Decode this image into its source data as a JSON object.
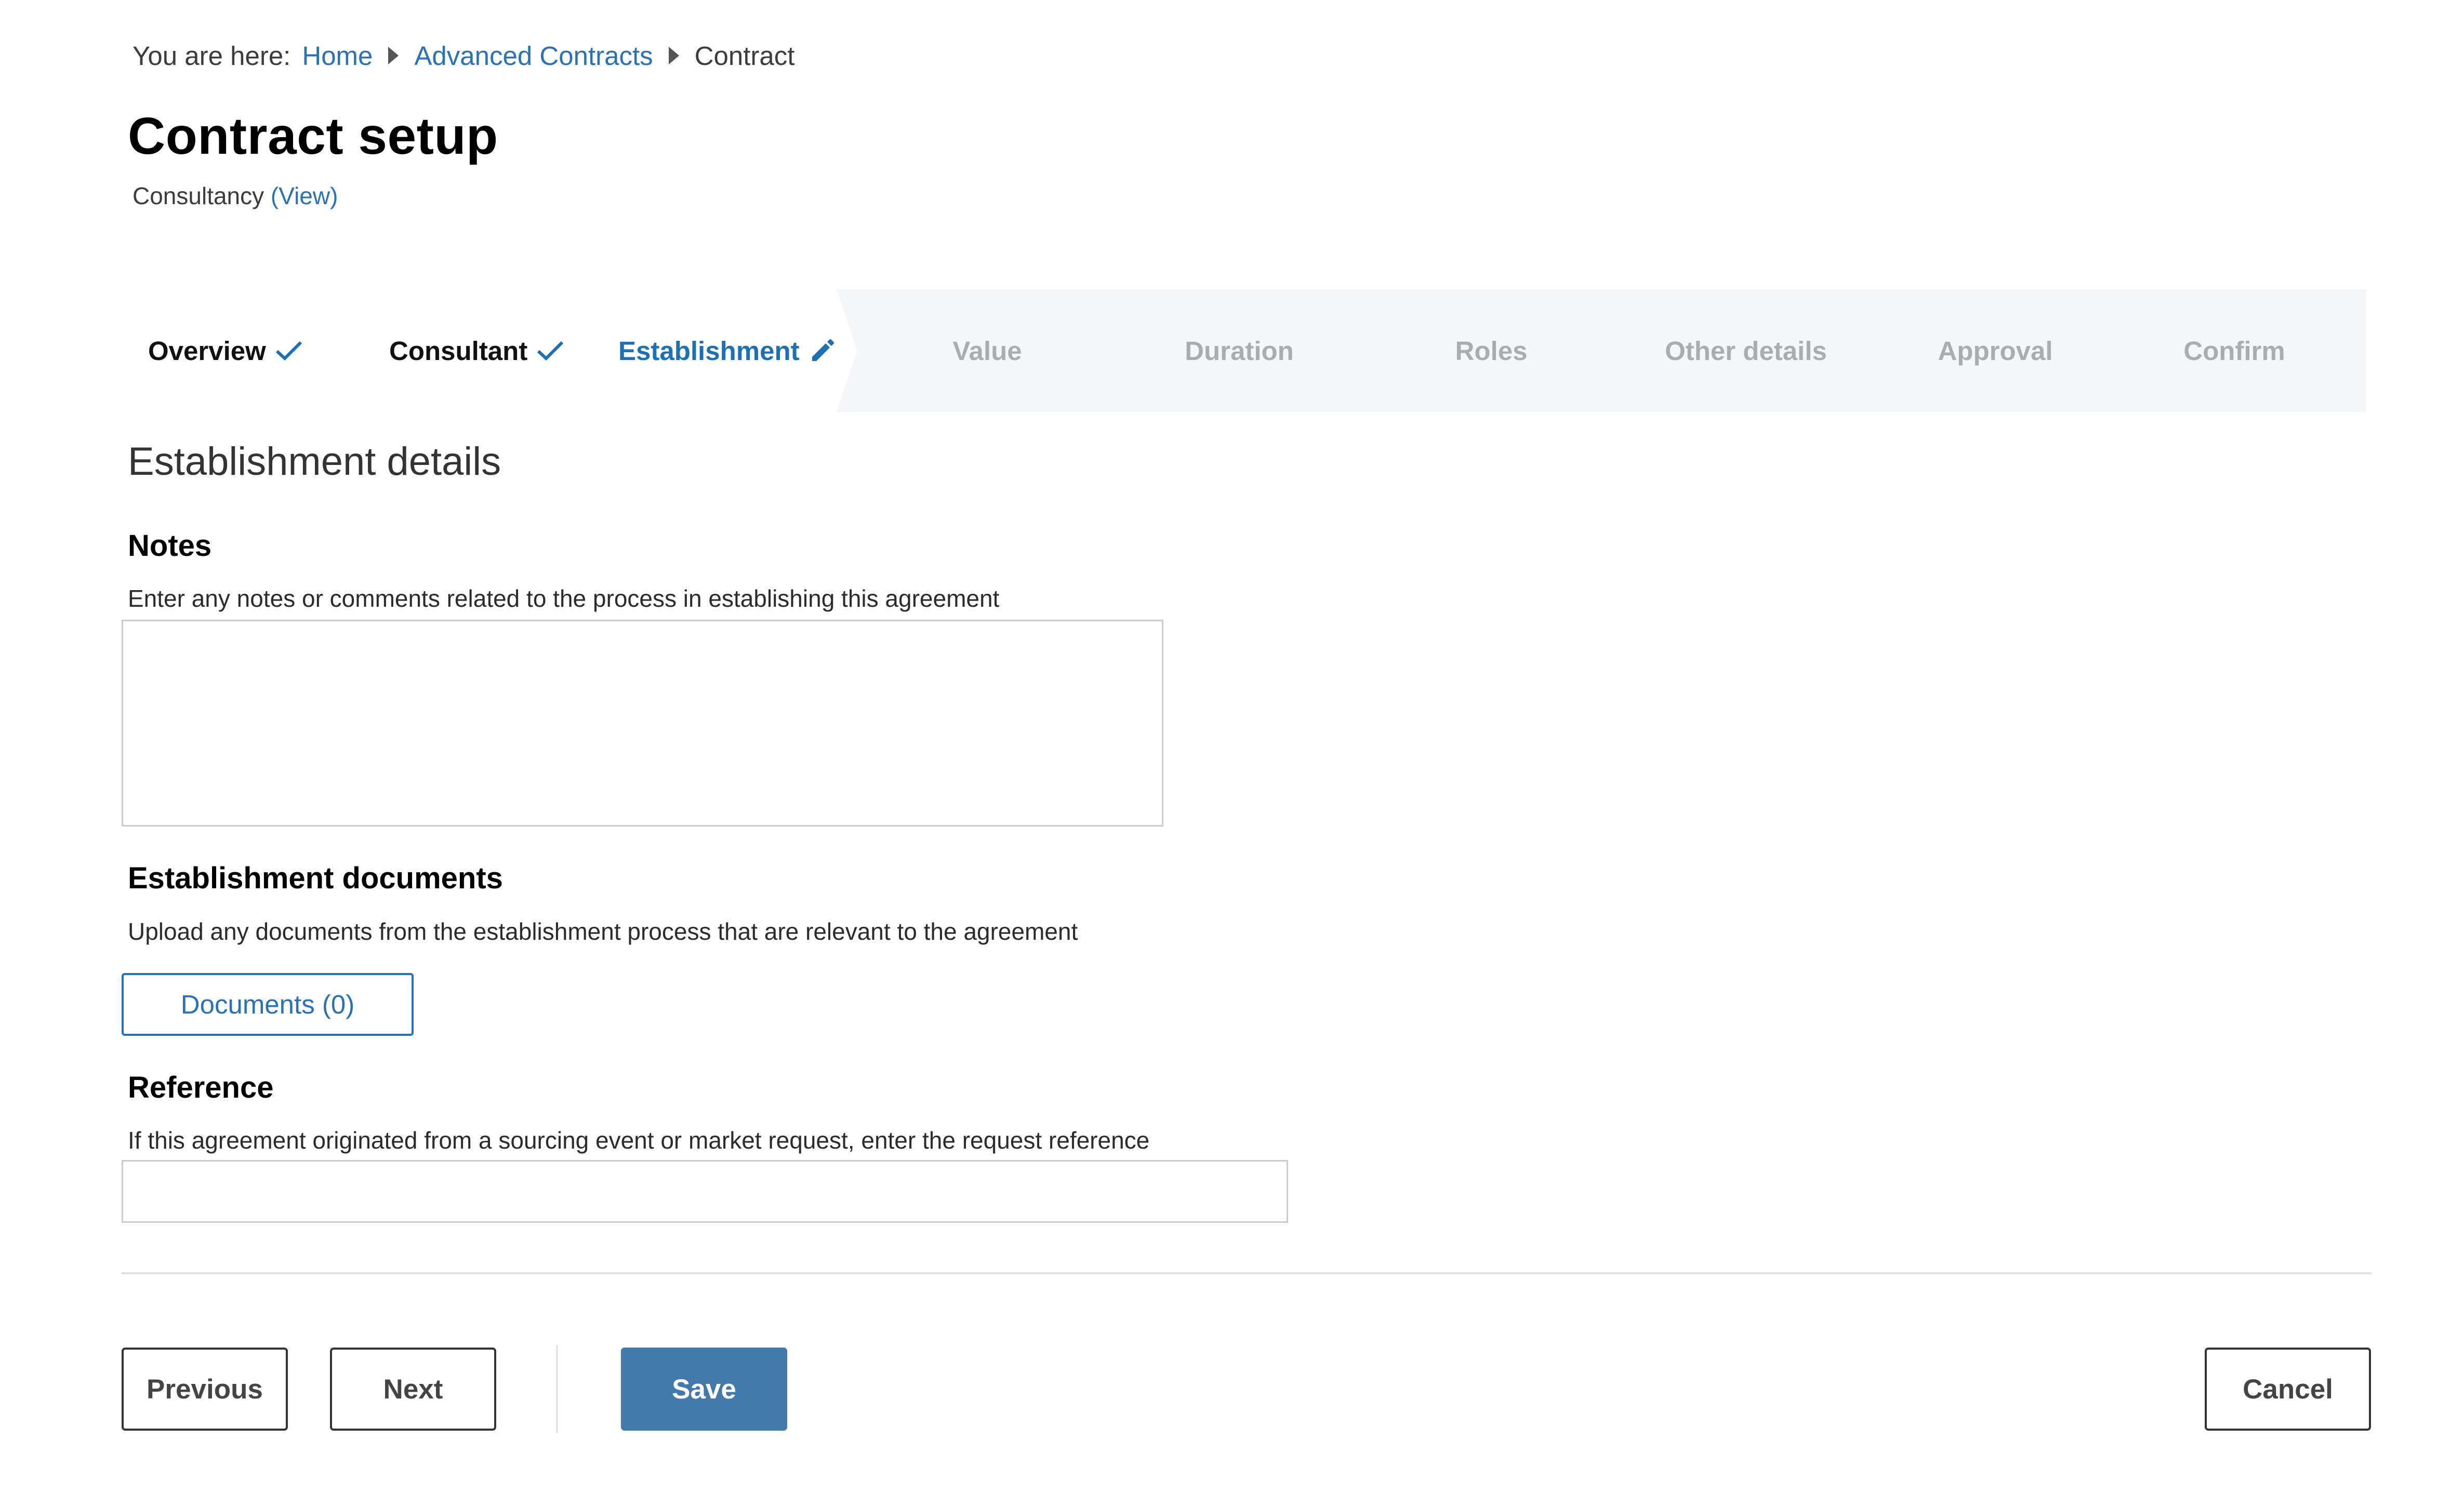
{
  "breadcrumb": {
    "prefix": "You are here:",
    "items": [
      "Home",
      "Advanced Contracts",
      "Contract"
    ]
  },
  "header": {
    "title": "Contract setup",
    "subtitle": "Consultancy",
    "subtitle_link": "(View)"
  },
  "stepper": {
    "steps": [
      {
        "label": "Overview",
        "state": "done",
        "icon": "check-icon"
      },
      {
        "label": "Consultant",
        "state": "done",
        "icon": "check-icon"
      },
      {
        "label": "Establishment",
        "state": "active",
        "icon": "pencil-icon"
      },
      {
        "label": "Value",
        "state": "todo"
      },
      {
        "label": "Duration",
        "state": "todo"
      },
      {
        "label": "Roles",
        "state": "todo"
      },
      {
        "label": "Other details",
        "state": "todo"
      },
      {
        "label": "Approval",
        "state": "todo"
      },
      {
        "label": "Confirm",
        "state": "todo"
      }
    ]
  },
  "form": {
    "section_title": "Establishment details",
    "notes": {
      "label": "Notes",
      "hint": "Enter any notes or comments related to the process in establishing this agreement",
      "value": ""
    },
    "documents": {
      "label": "Establishment documents",
      "hint": "Upload any documents from the establishment process that are relevant to the agreement",
      "button_label": "Documents (0)"
    },
    "reference": {
      "label": "Reference",
      "hint": "If this agreement originated from a sourcing event or market request, enter the request reference",
      "value": ""
    }
  },
  "footer": {
    "previous_label": "Previous",
    "next_label": "Next",
    "save_label": "Save",
    "cancel_label": "Cancel"
  },
  "colors": {
    "accent": "#2a72b5",
    "primary_button": "#4479ac",
    "stepper_background": "#f5f6f8",
    "inactive_step": "#a9adb2"
  }
}
